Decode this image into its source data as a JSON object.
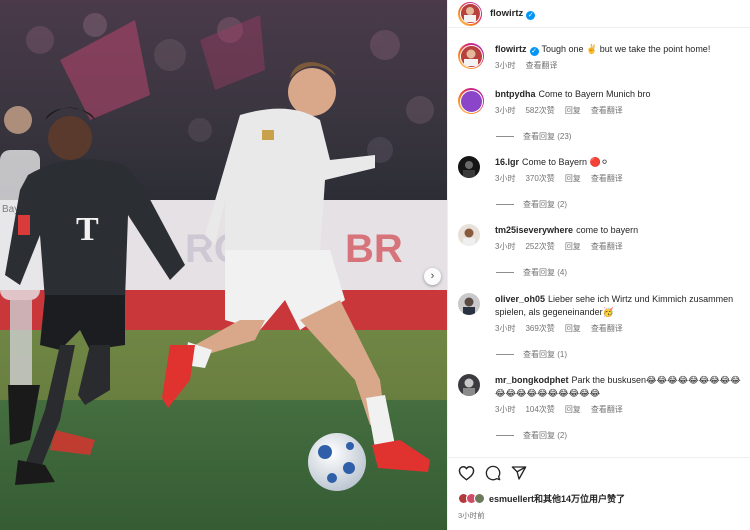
{
  "post": {
    "author": "flowirtz",
    "caption_text": "Tough one ✌️ but we take the point home!",
    "caption_time": "3小时",
    "caption_translate": "查看翻译"
  },
  "comments": [
    {
      "user": "bntpydha",
      "text": "Come to Bayern Munich bro",
      "time": "3小时",
      "likes": "582次赞",
      "reply": "回复",
      "translate": "查看翻译",
      "replies": "查看回复 (23)"
    },
    {
      "user": "16.lgr",
      "text": "Come to Bayern 🔴⚪",
      "time": "3小时",
      "likes": "370次赞",
      "reply": "回复",
      "translate": "查看翻译",
      "replies": "查看回复 (2)"
    },
    {
      "user": "tm25iseverywhere",
      "text": "come to bayern",
      "time": "3小时",
      "likes": "252次赞",
      "reply": "回复",
      "translate": "查看翻译",
      "replies": "查看回复 (4)"
    },
    {
      "user": "oliver_oh05",
      "text": "Lieber sehe ich Wirtz und Kimmich zusammen spielen, als gegeneinander🥳",
      "time": "3小时",
      "likes": "369次赞",
      "reply": "回复",
      "translate": "查看翻译",
      "replies": "查看回复 (1)"
    },
    {
      "user": "mr_bongkodphet",
      "text": "Park the buskusen😂😂😂😂😂😂😂😂😂😂😂😂😂😂😂😂😂😂😂",
      "time": "3小时",
      "likes": "104次赞",
      "reply": "回复",
      "translate": "查看翻译",
      "replies": "查看回复 (2)"
    }
  ],
  "footer": {
    "liked_by": "esmuellert和其他14万位用户赞了",
    "time": "3小时前"
  },
  "image": {
    "board_text_1": "Bay",
    "board_text_2": "BR",
    "board_text_3": "RO",
    "jersey_logo": "T"
  },
  "icons": [
    "verified-badge-icon",
    "heart-icon",
    "comment-icon",
    "share-icon",
    "next-arrow-icon"
  ],
  "colors": {
    "verified": "#0095f6",
    "meta_text": "#737373",
    "pitch": "#3f6b3c",
    "bayern_kit": "#2b2e33",
    "leverkusen_kit": "#e9e9ea",
    "boots_red": "#e0322f"
  }
}
